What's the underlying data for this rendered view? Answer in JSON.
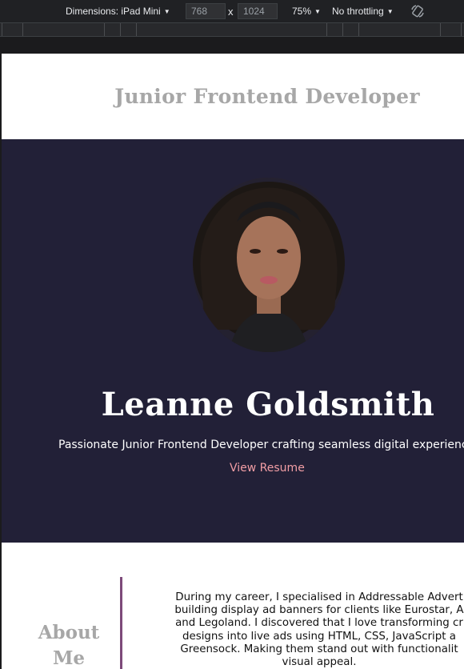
{
  "devtools": {
    "dimensions_label": "Dimensions: iPad Mini",
    "width_value": "768",
    "height_value": "1024",
    "times_symbol": "x",
    "zoom": "75%",
    "throttling": "No throttling",
    "icons": {
      "caret": "caret-down-icon",
      "rotate": "rotate-icon"
    }
  },
  "site": {
    "header_title": "Junior Frontend Developer",
    "hero": {
      "name": "Leanne Goldsmith",
      "tagline": "Passionate Junior Frontend Developer crafting seamless digital experienc",
      "resume_link": "View Resume"
    },
    "about": {
      "title": "About Me",
      "text": "During my career, I specialised in Addressable Advert\nbuilding display ad banners for clients like Eurostar, A\nand Legoland. I discovered that I love transforming cr\ndesigns into live ads using HTML, CSS, JavaScript a\nGreensock. Making them stand out with functionalit\nvisual appeal."
    },
    "colors": {
      "hero_bg": "#222037",
      "link": "#f29ea5",
      "heading_gray": "#a7a7a7",
      "divider": "#7d4a7a"
    }
  }
}
